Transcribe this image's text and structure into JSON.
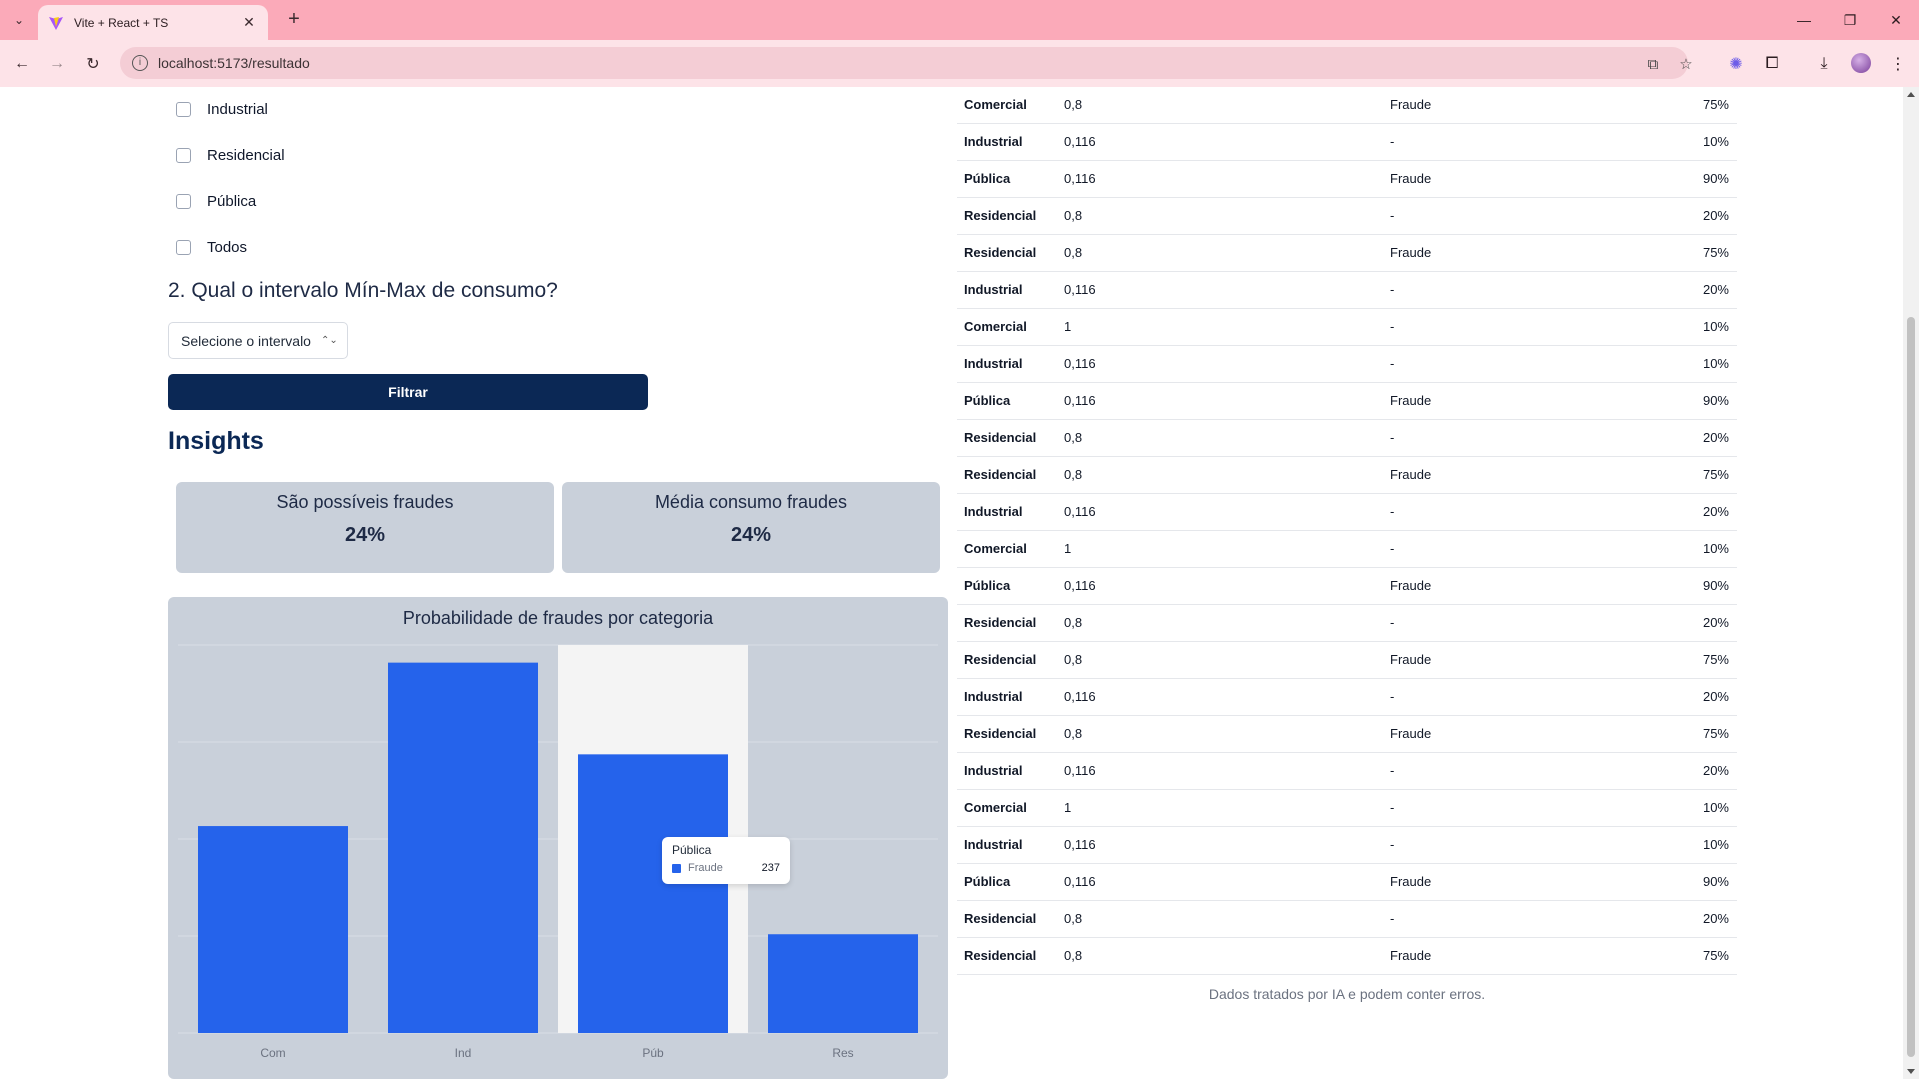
{
  "browser": {
    "tab_title": "Vite + React + TS",
    "url": "localhost:5173/resultado"
  },
  "filters": {
    "options": [
      "Industrial",
      "Residencial",
      "Pública",
      "Todos"
    ],
    "question2": "2. Qual o intervalo Mín-Max de consumo?",
    "select_placeholder": "Selecione o intervalo",
    "filter_button": "Filtrar"
  },
  "insights": {
    "heading": "Insights",
    "cards": [
      {
        "title": "São possíveis fraudes",
        "value": "24%"
      },
      {
        "title": "Média consumo fraudes",
        "value": "24%"
      }
    ]
  },
  "chart_data": {
    "type": "bar",
    "title": "Probabilidade de fraudes por categoria",
    "categories": [
      "Com",
      "Ind",
      "Púb",
      "Res"
    ],
    "series": [
      {
        "name": "Fraude",
        "values": [
          176,
          315,
          237,
          84
        ]
      }
    ],
    "ylim": [
      0,
      330
    ],
    "grid": true,
    "bar_color": "#2563eb",
    "highlight_color": "#f4f4f4",
    "highlight_index": 2,
    "tooltip": {
      "title": "Pública",
      "series": "Fraude",
      "value": "237"
    }
  },
  "table": {
    "rows": [
      [
        "Comercial",
        "0,8",
        "Fraude",
        "75%"
      ],
      [
        "Industrial",
        "0,116",
        "-",
        "10%"
      ],
      [
        "Pública",
        "0,116",
        "Fraude",
        "90%"
      ],
      [
        "Residencial",
        "0,8",
        "-",
        "20%"
      ],
      [
        "Residencial",
        "0,8",
        "Fraude",
        "75%"
      ],
      [
        "Industrial",
        "0,116",
        "-",
        "20%"
      ],
      [
        "Comercial",
        "1",
        "-",
        "10%"
      ],
      [
        "Industrial",
        "0,116",
        "-",
        "10%"
      ],
      [
        "Pública",
        "0,116",
        "Fraude",
        "90%"
      ],
      [
        "Residencial",
        "0,8",
        "-",
        "20%"
      ],
      [
        "Residencial",
        "0,8",
        "Fraude",
        "75%"
      ],
      [
        "Industrial",
        "0,116",
        "-",
        "20%"
      ],
      [
        "Comercial",
        "1",
        "-",
        "10%"
      ],
      [
        "Pública",
        "0,116",
        "Fraude",
        "90%"
      ],
      [
        "Residencial",
        "0,8",
        "-",
        "20%"
      ],
      [
        "Residencial",
        "0,8",
        "Fraude",
        "75%"
      ],
      [
        "Industrial",
        "0,116",
        "-",
        "20%"
      ],
      [
        "Residencial",
        "0,8",
        "Fraude",
        "75%"
      ],
      [
        "Industrial",
        "0,116",
        "-",
        "20%"
      ],
      [
        "Comercial",
        "1",
        "-",
        "10%"
      ],
      [
        "Industrial",
        "0,116",
        "-",
        "10%"
      ],
      [
        "Pública",
        "0,116",
        "Fraude",
        "90%"
      ],
      [
        "Residencial",
        "0,8",
        "-",
        "20%"
      ],
      [
        "Residencial",
        "0,8",
        "Fraude",
        "75%"
      ]
    ],
    "footnote": "Dados tratados por IA e podem conter erros."
  },
  "colors": {
    "chrome_tabstrip": "#fbaab9",
    "chrome_toolbar": "#fde3e8",
    "primary_button": "#0b2855",
    "card_bg": "#c9d0da",
    "bar": "#2563eb"
  }
}
